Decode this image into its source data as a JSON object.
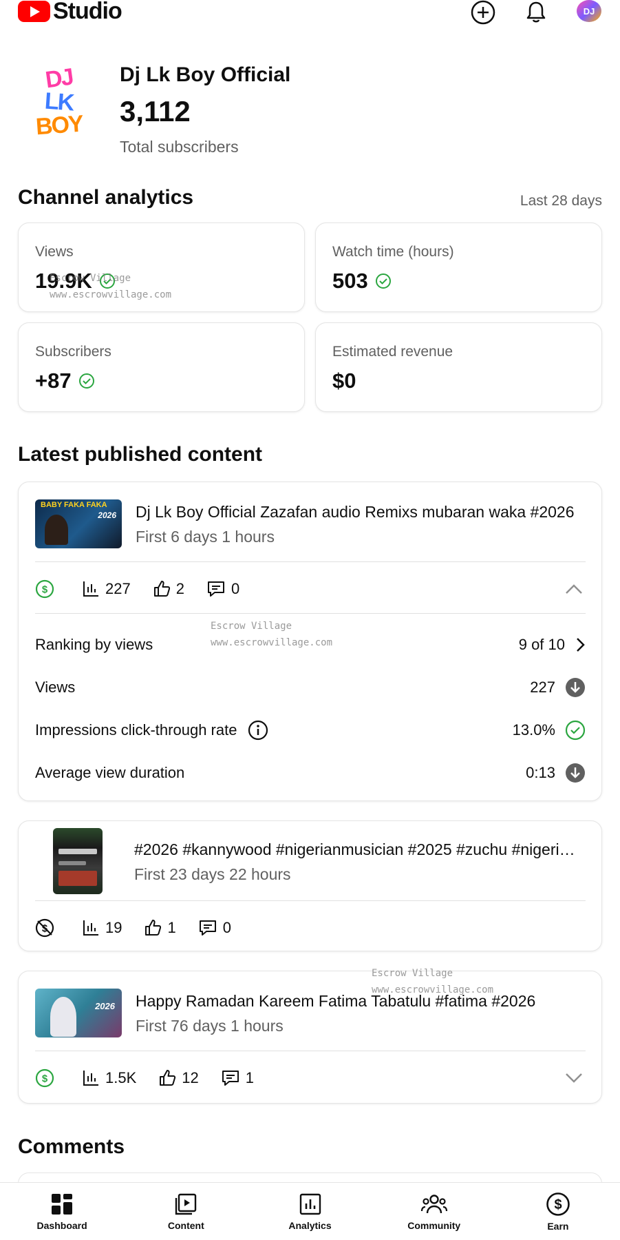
{
  "header": {
    "brand": "Studio",
    "colors": {
      "brand_red": "#ff0000",
      "success_green": "#2ba640"
    }
  },
  "channel": {
    "name": "Dj Lk Boy Official",
    "subscribers": "3,112",
    "subscribers_label": "Total subscribers",
    "avatar_text": {
      "line1": "DJ",
      "line2": "LK",
      "line3": "BOY"
    },
    "small_avatar_text": "DJ"
  },
  "analytics": {
    "title": "Channel analytics",
    "range": "Last 28 days",
    "cards": [
      {
        "label": "Views",
        "value": "19.9K",
        "check": true
      },
      {
        "label": "Watch time (hours)",
        "value": "503",
        "check": true
      },
      {
        "label": "Subscribers",
        "value": "+87",
        "check": true
      },
      {
        "label": "Estimated revenue",
        "value": "$0",
        "check": false
      }
    ]
  },
  "latest": {
    "title": "Latest published content",
    "videos": [
      {
        "title": "Dj Lk Boy Official Zazafan audio Remixs mubaran waka #2026",
        "subtitle": "First 6 days 1 hours",
        "thumb_text": "BABY FAKA FAKA",
        "thumb_badge": "2026",
        "monetized": true,
        "views": "227",
        "likes": "2",
        "comments": "0",
        "expanded": true,
        "details": {
          "ranking_label": "Ranking by views",
          "ranking_value": "9 of 10",
          "views_label": "Views",
          "views_value": "227",
          "ctr_label": "Impressions click-through rate",
          "ctr_value": "13.0%",
          "avd_label": "Average view duration",
          "avd_value": "0:13"
        }
      },
      {
        "title": "#2026 #kannywood #nigerianmusician #2025 #zuchu #nigerian…",
        "subtitle": "First 23 days 22 hours",
        "monetized": false,
        "views": "19",
        "likes": "1",
        "comments": "0",
        "expanded": false
      },
      {
        "title": "Happy Ramadan Kareem Fatima Tabatulu #fatima #2026",
        "subtitle": "First 76 days 1 hours",
        "thumb_badge": "2026",
        "monetized": true,
        "views": "1.5K",
        "likes": "12",
        "comments": "1",
        "expanded": false
      }
    ]
  },
  "comments": {
    "title": "Comments"
  },
  "watermark": {
    "line1": "Escrow Village",
    "line2": "www.escrowvillage.com"
  },
  "nav": [
    {
      "label": "Dashboard",
      "icon": "dashboard-icon"
    },
    {
      "label": "Content",
      "icon": "content-icon"
    },
    {
      "label": "Analytics",
      "icon": "analytics-icon"
    },
    {
      "label": "Community",
      "icon": "community-icon"
    },
    {
      "label": "Earn",
      "icon": "earn-icon"
    }
  ]
}
